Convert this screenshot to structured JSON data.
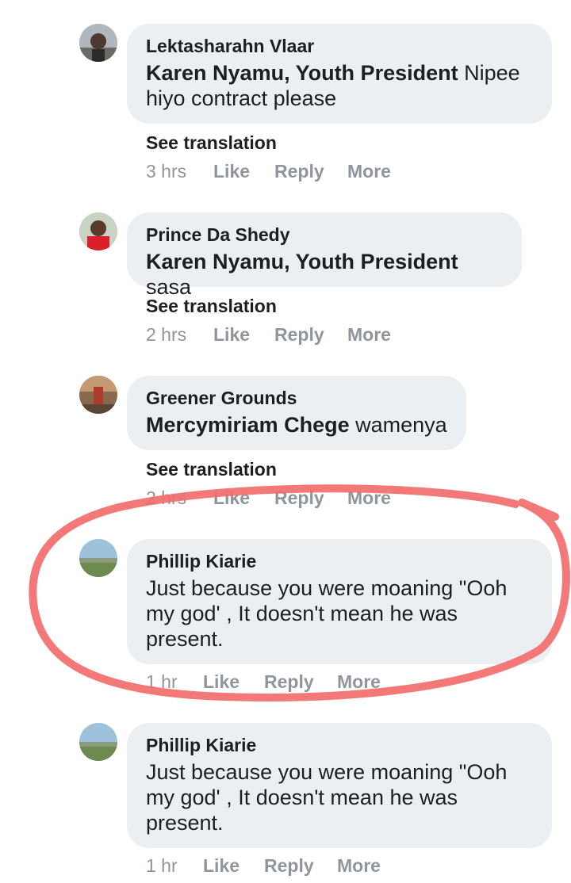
{
  "comments": [
    {
      "author": "Lektasharahn Vlaar",
      "mention": "Karen Nyamu, Youth President",
      "text_line1": " Nipee",
      "text_line2": "hiyo contract please",
      "see_translation": "See translation",
      "time": "3 hrs"
    },
    {
      "author": "Prince Da Shedy",
      "mention": "Karen Nyamu, Youth President",
      "text": " sasa",
      "see_translation": "See translation",
      "time": "2 hrs"
    },
    {
      "author": "Greener Grounds",
      "mention": "Mercymiriam Chege",
      "text": " wamenya",
      "see_translation": "See translation",
      "time": "2 hrs"
    },
    {
      "author": "Phillip Kiarie",
      "text_line1": "Just because you were moaning \"Ooh",
      "text_line2": "my god' , It doesn't mean he was",
      "text_line3": "present.",
      "time": "1 hr"
    },
    {
      "author": "Phillip Kiarie",
      "text_line1": "Just because you were moaning \"Ooh",
      "text_line2": "my god' , It doesn't mean he was",
      "text_line3": "present.",
      "time": "1 hr"
    }
  ],
  "actions": {
    "like": "Like",
    "reply": "Reply",
    "more": "More"
  },
  "colors": {
    "bubble": "#eceff1",
    "meta": "#90949c",
    "highlight": "#f26d6d"
  }
}
